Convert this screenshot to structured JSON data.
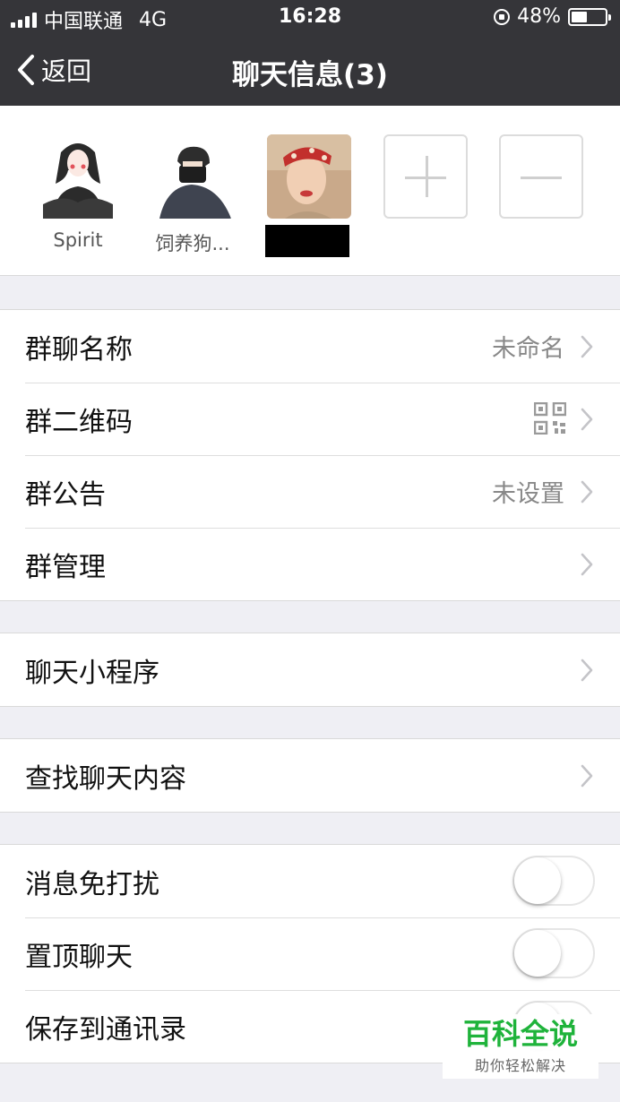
{
  "status_bar": {
    "carrier": "中国联通",
    "network": "4G",
    "time": "16:28",
    "battery": "48%",
    "battery_level": 0.48
  },
  "nav": {
    "back_label": "返回",
    "title": "聊天信息(3)"
  },
  "members": [
    {
      "name": "Spirit"
    },
    {
      "name": "饲养狗..."
    },
    {
      "name": ""
    }
  ],
  "settings": {
    "group_name": {
      "label": "群聊名称",
      "value": "未命名"
    },
    "group_qr": {
      "label": "群二维码"
    },
    "group_notice": {
      "label": "群公告",
      "value": "未设置"
    },
    "group_manage": {
      "label": "群管理"
    },
    "mini_programs": {
      "label": "聊天小程序"
    },
    "search_history": {
      "label": "查找聊天内容"
    },
    "mute": {
      "label": "消息免打扰",
      "on": false
    },
    "sticky": {
      "label": "置顶聊天",
      "on": false
    },
    "save_contacts": {
      "label": "保存到通讯录",
      "on": false
    }
  },
  "watermark": {
    "main": "百科全说",
    "sub": "助你轻松解决"
  },
  "colors": {
    "nav_bg": "#353539",
    "page_bg": "#efeff4",
    "watermark_green": "#1fb33b"
  }
}
